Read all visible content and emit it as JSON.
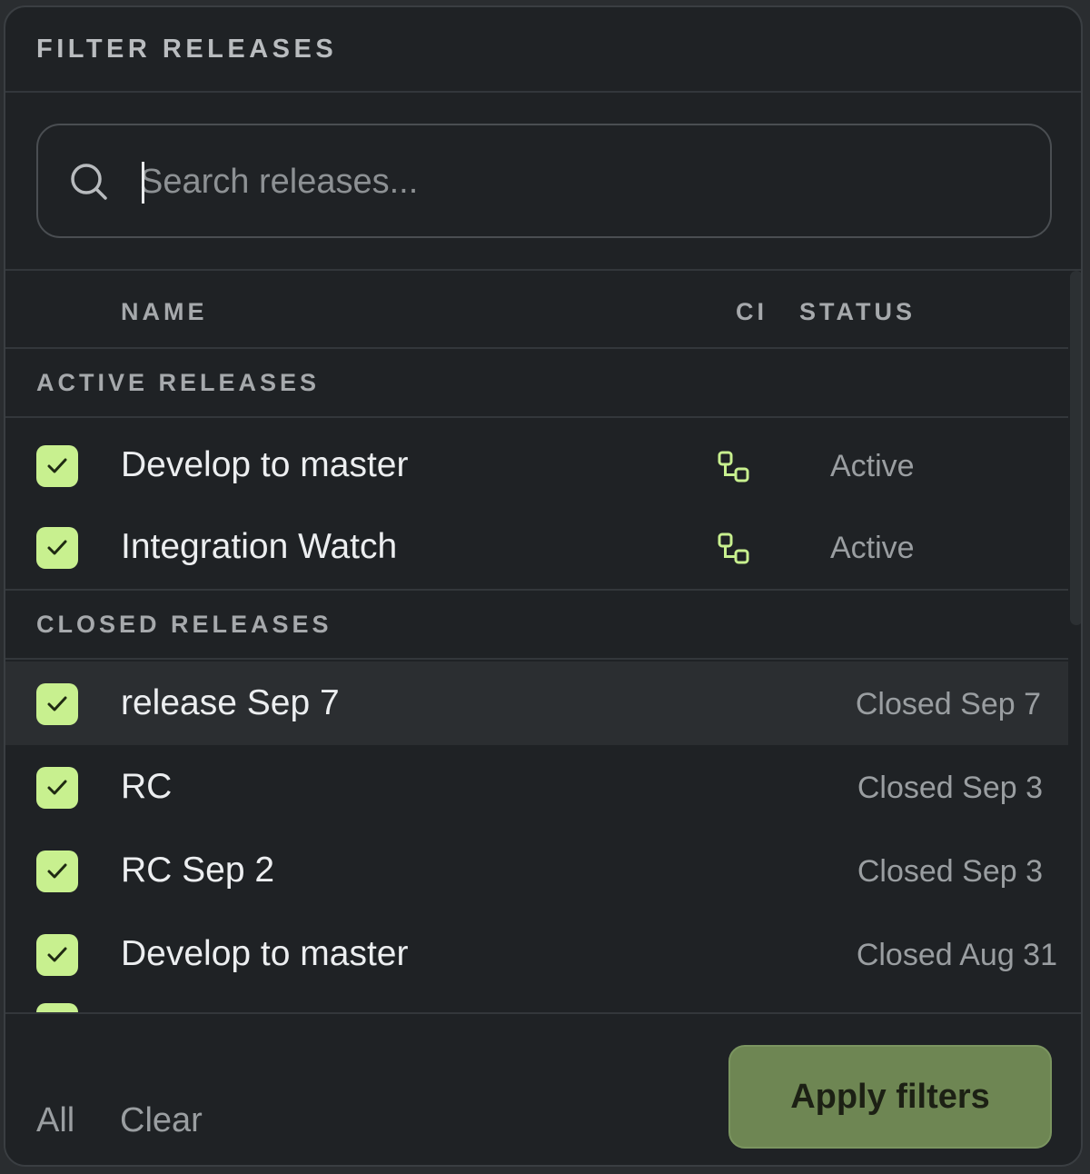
{
  "panel": {
    "title": "FILTER RELEASES"
  },
  "search": {
    "placeholder": "Search releases...",
    "value": ""
  },
  "columns": {
    "name": "NAME",
    "ci": "CI",
    "status": "STATUS"
  },
  "sections": {
    "active": {
      "label": "ACTIVE RELEASES",
      "rows": [
        {
          "name": "Develop to master",
          "status": "Active",
          "checked": true,
          "ci_icon": "pipeline-icon"
        },
        {
          "name": "Integration Watch",
          "status": "Active",
          "checked": true,
          "ci_icon": "pipeline-icon"
        }
      ]
    },
    "closed": {
      "label": "CLOSED RELEASES",
      "rows": [
        {
          "name": "release Sep 7",
          "status": "Closed Sep 7",
          "checked": true
        },
        {
          "name": "RC",
          "status": "Closed Sep 3",
          "checked": true
        },
        {
          "name": "RC Sep 2",
          "status": "Closed Sep 3",
          "checked": true
        },
        {
          "name": "Develop to master",
          "status": "Closed Aug 31",
          "checked": true
        }
      ]
    }
  },
  "footer": {
    "all_label": "All",
    "clear_label": "Clear",
    "apply_label": "Apply filters"
  },
  "colors": {
    "accent": "#c8f08f",
    "apply_button": "#6e8653",
    "background": "#1f2225"
  }
}
